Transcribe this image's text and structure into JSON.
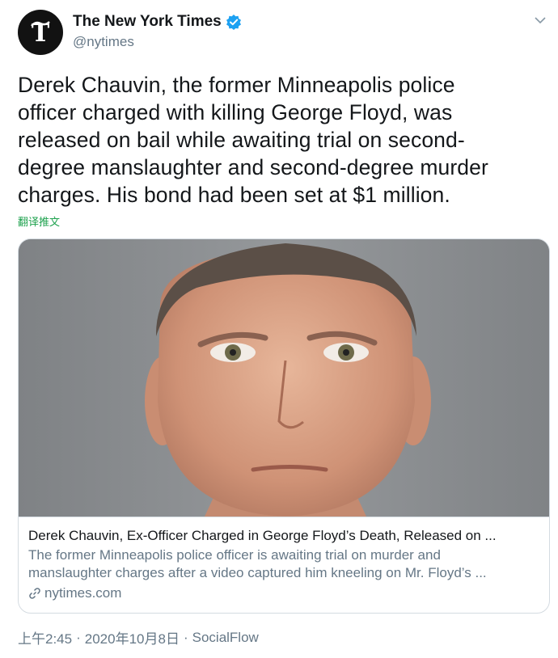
{
  "account": {
    "display_name": "The New York Times",
    "handle": "@nytimes",
    "verified": true,
    "avatar_icon": "nyt-logo-icon"
  },
  "tweet": {
    "text_lines": [
      "Derek Chauvin, the former Minneapolis police",
      "officer charged with killing George Floyd, was",
      "released on bail while awaiting trial on second-",
      "degree manslaughter and second-degree murder",
      "charges. His bond had been set at $1 million."
    ],
    "translate_label": "翻译推文"
  },
  "card": {
    "title": "Derek Chauvin, Ex-Officer Charged in George Floyd’s Death, Released on ...",
    "description_lines": [
      "The former Minneapolis police officer is awaiting trial on murder and",
      "manslaughter charges after a video captured him kneeling on Mr. Floyd’s ..."
    ],
    "domain": "nytimes.com"
  },
  "footer": {
    "time": "上午2:45",
    "separator": "·",
    "date": "2020年10月8日",
    "source": "SocialFlow"
  },
  "colors": {
    "text": "#14171a",
    "secondary": "#657786",
    "verified_blue": "#1da1f2",
    "translate_green": "#1da14d",
    "border": "#d4dbe1"
  }
}
